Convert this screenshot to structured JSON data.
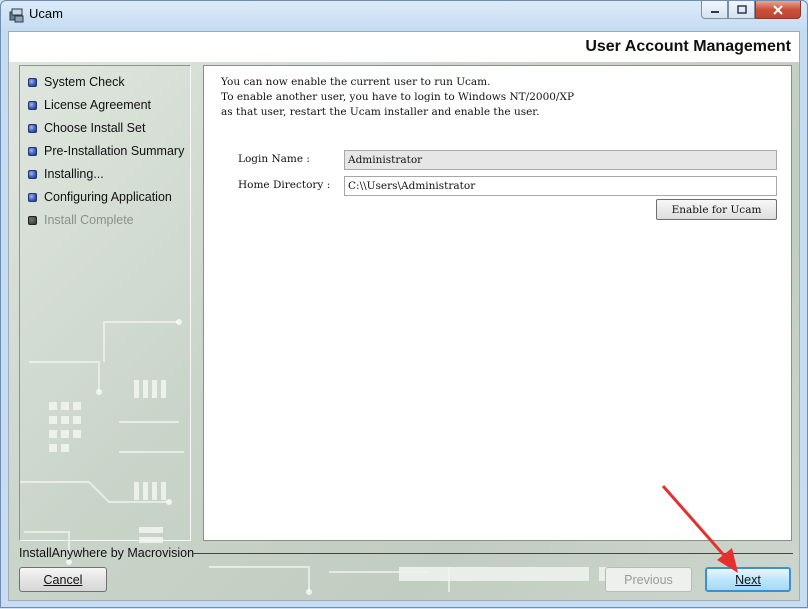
{
  "window": {
    "title": "Ucam"
  },
  "header": {
    "title": "User Account Management"
  },
  "steps": [
    {
      "label": "System Check",
      "state": "done"
    },
    {
      "label": "License Agreement",
      "state": "done"
    },
    {
      "label": "Choose Install Set",
      "state": "done"
    },
    {
      "label": "Pre-Installation Summary",
      "state": "done"
    },
    {
      "label": "Installing...",
      "state": "done"
    },
    {
      "label": "Configuring Application",
      "state": "current"
    },
    {
      "label": "Install Complete",
      "state": "pending"
    }
  ],
  "panel": {
    "message": "You can now enable the current user to run Ucam.\nTo enable another user, you have to login to Windows NT/2000/XP\nas that user, restart the Ucam installer and enable the user.",
    "login_label": "Login Name :",
    "login_value": "Administrator",
    "home_label": "Home Directory :",
    "home_value": "C:\\\\Users\\Administrator",
    "enable_button": "Enable for Ucam"
  },
  "footer": {
    "vendor": "InstallAnywhere by Macrovision",
    "cancel_label": "Cancel",
    "previous_label": "Previous",
    "next_label": "Next"
  },
  "colors": {
    "accent": "#3c8fd6",
    "close_red": "#c8513a",
    "annotation_arrow": "#e53030"
  }
}
